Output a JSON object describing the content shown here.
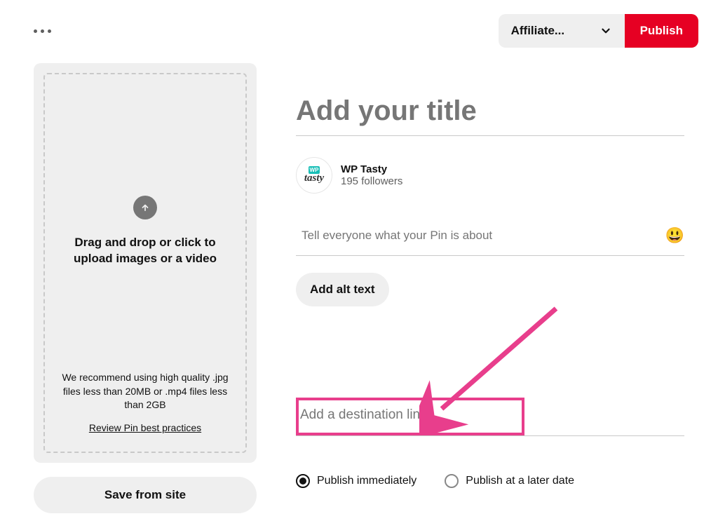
{
  "top": {
    "board_selected": "Affiliate...",
    "publish_label": "Publish"
  },
  "upload": {
    "drag_text": "Drag and drop or click to upload images or a video",
    "recommend_text": "We recommend using high quality .jpg files less than 20MB or .mp4 files less than 2GB",
    "best_practices_label": "Review Pin best practices",
    "save_from_site_label": "Save from site"
  },
  "form": {
    "title_placeholder": "Add your title",
    "author_name": "WP Tasty",
    "followers": "195 followers",
    "desc_placeholder": "Tell everyone what your Pin is about",
    "alt_text_label": "Add alt text",
    "link_placeholder": "Add a destination link"
  },
  "publish_options": {
    "immediate": "Publish immediately",
    "later": "Publish at a later date",
    "selected": "immediate"
  }
}
